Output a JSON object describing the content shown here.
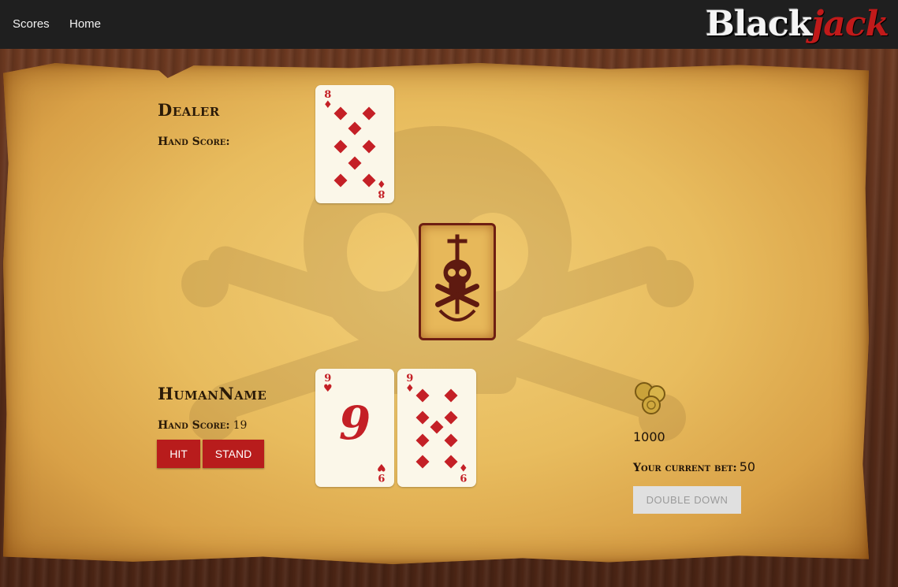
{
  "nav": {
    "scores": "Scores",
    "home": "Home"
  },
  "brand": {
    "part1": "Black",
    "part2": "jack"
  },
  "dealer": {
    "name": "Dealer",
    "score_label": "Hand Score:",
    "score_value": "",
    "cards": [
      {
        "rank": "8",
        "suit": "diamonds"
      }
    ],
    "hidden_card": "card-back"
  },
  "player": {
    "name": "HumanName",
    "score_label": "Hand Score:",
    "score_value": "19",
    "cards": [
      {
        "rank": "9",
        "suit": "hearts"
      },
      {
        "rank": "9",
        "suit": "diamonds"
      }
    ],
    "hit_label": "HIT",
    "stand_label": "STAND"
  },
  "wallet": {
    "balance": "1000",
    "bet_label": "Your current bet:",
    "bet_value": "50",
    "double_down_label": "DOUBLE DOWN",
    "double_down_enabled": false
  },
  "colors": {
    "accent": "#b81c1c",
    "navbar": "#1f1f1f",
    "card_red": "#c42026"
  }
}
